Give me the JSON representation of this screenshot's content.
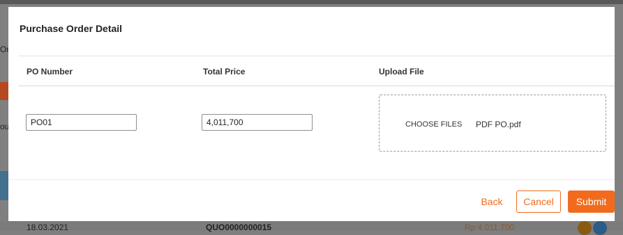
{
  "background": {
    "fragments": [
      "Or",
      "ou"
    ],
    "row": {
      "date": "18.03.2021",
      "quotation": "QUO0000000015",
      "price": "Rp 4.011.700"
    }
  },
  "modal": {
    "title": "Purchase Order Detail",
    "columns": {
      "po_number": "PO Number",
      "total_price": "Total Price",
      "upload_file": "Upload File"
    },
    "po_number_value": "PO01",
    "total_price_value": "4,011,700",
    "upload": {
      "choose_label": "CHOOSE FILES",
      "file_name": "PDF PO.pdf"
    },
    "buttons": {
      "back": "Back",
      "cancel": "Cancel",
      "submit": "Submit"
    }
  },
  "colors": {
    "accent": "#f26b1d",
    "overlay": "#808080"
  }
}
